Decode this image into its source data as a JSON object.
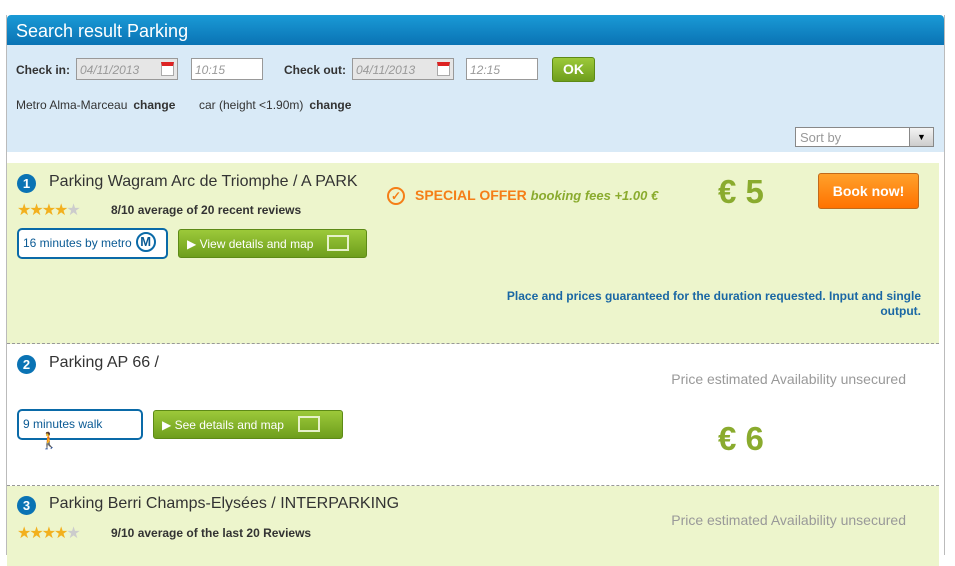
{
  "header": {
    "title": "Search result Parking"
  },
  "filters": {
    "checkin_label": "Check in:",
    "checkin_date": "04/11/2013",
    "checkin_time": "10:15",
    "checkout_label": "Check out:",
    "checkout_date": "04/11/2013",
    "checkout_time": "12:15",
    "ok": "OK",
    "location": "Metro Alma-Marceau",
    "vehicle": "car (height <1.90m)",
    "change": "change",
    "sort_placeholder": "Sort by"
  },
  "results": [
    {
      "num": "1",
      "title": "Parking Wagram Arc de Triomphe / A PARK",
      "rating": 4,
      "reviews": "8/10 average of 20 recent reviews",
      "distance": "16 minutes by metro",
      "distance_icon": "M",
      "details": "View details and map",
      "offer": "SPECIAL OFFER",
      "offer_fee": "booking fees +1.00 €",
      "price": "€ 5",
      "book": "Book now!",
      "guarantee": "Place and prices guaranteed for the duration requested. Input and single output."
    },
    {
      "num": "2",
      "title": "Parking AP 66 /",
      "distance": "9 minutes walk",
      "details": "See details and map",
      "estimate": "Price estimated Availability unsecured",
      "price": "€ 6"
    },
    {
      "num": "3",
      "title": "Parking Berri Champs-Elysées / INTERPARKING",
      "rating": 4,
      "reviews": "9/10 average of the last 20 Reviews",
      "estimate": "Price estimated Availability unsecured"
    }
  ],
  "colors": {
    "header": "#0a73b4",
    "filters_bg": "#d9eaf7",
    "result_bg": "#edf5cc",
    "price": "#8aab2e",
    "book": "#ff7200",
    "offer": "#f57e17"
  }
}
